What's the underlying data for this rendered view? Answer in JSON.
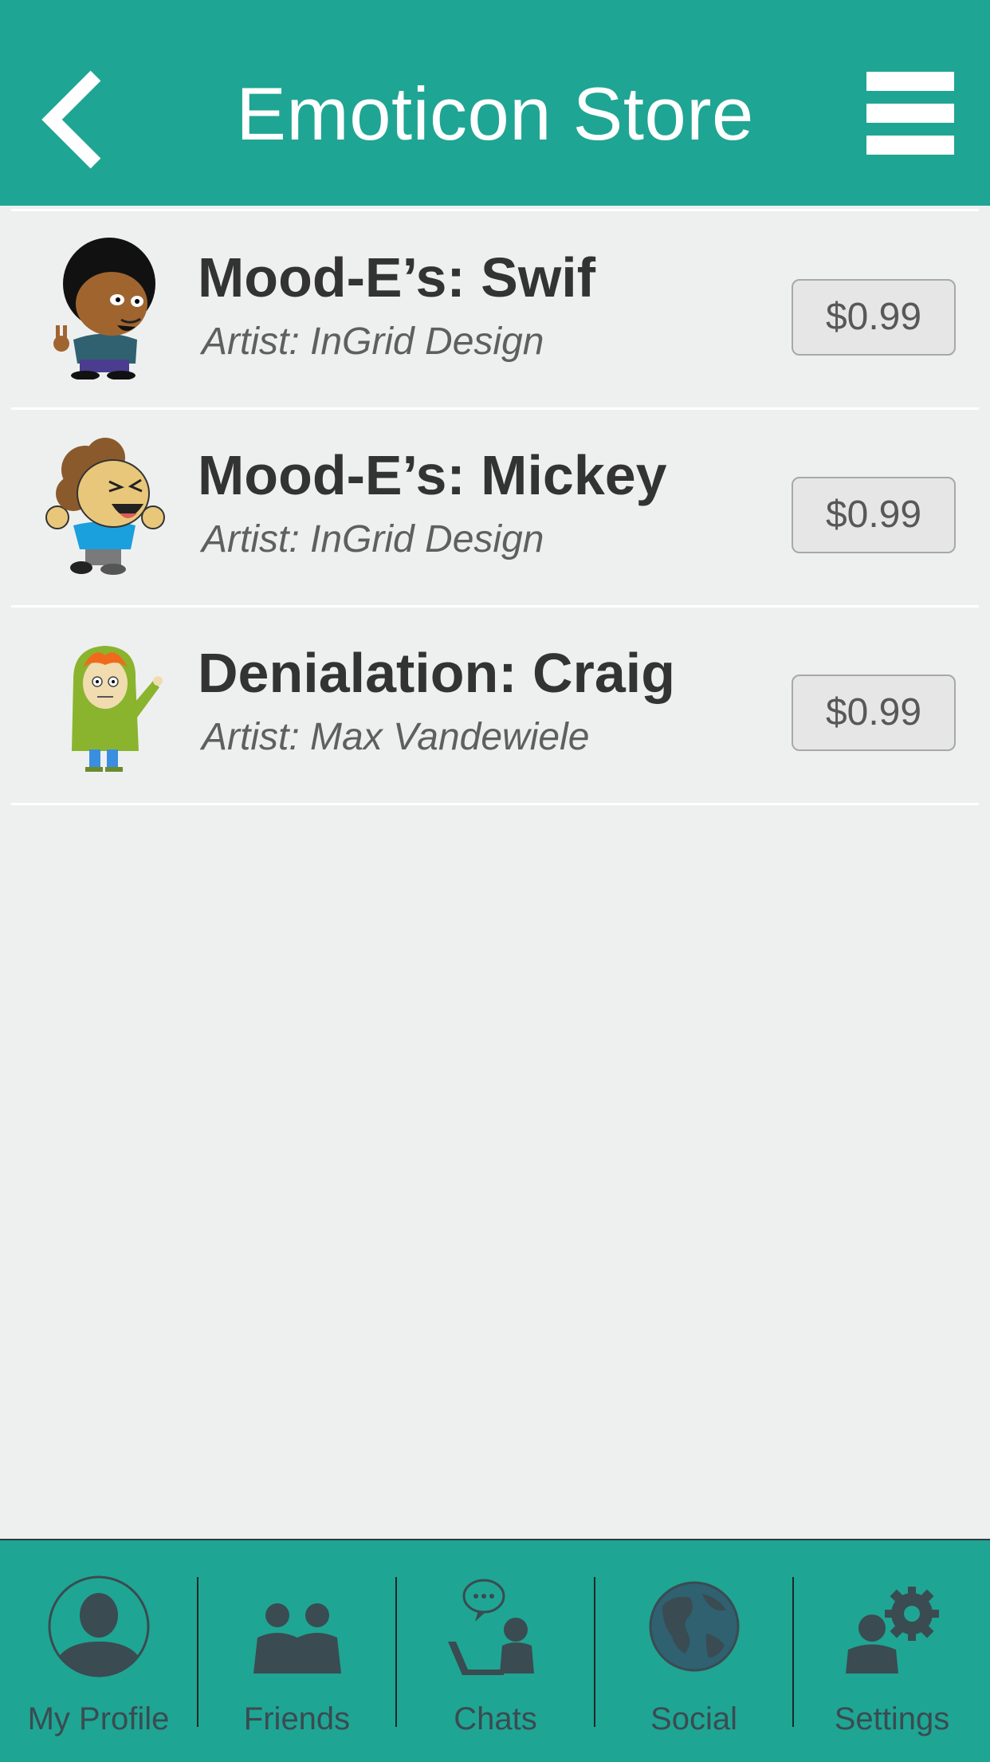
{
  "header": {
    "title": "Emoticon Store",
    "back_icon": "chevron-left-icon",
    "menu_icon": "hamburger-menu-icon"
  },
  "packs": [
    {
      "name": "Mood-E’s: Swif",
      "artist": "Artist: InGrid Design",
      "price": "$0.99"
    },
    {
      "name": "Mood-E’s: Mickey",
      "artist": "Artist: InGrid Design",
      "price": "$0.99"
    },
    {
      "name": "Denialation: Craig",
      "artist": "Artist: Max Vandewiele",
      "price": "$0.99"
    }
  ],
  "tabs": [
    {
      "label": "My Profile",
      "icon": "profile-icon"
    },
    {
      "label": "Friends",
      "icon": "friends-icon"
    },
    {
      "label": "Chats",
      "icon": "chats-icon"
    },
    {
      "label": "Social",
      "icon": "globe-icon"
    },
    {
      "label": "Settings",
      "icon": "settings-gear-icon"
    }
  ],
  "colors": {
    "brand": "#1fa593",
    "background": "#eef0f0",
    "tab_icon": "#3a4b52"
  }
}
